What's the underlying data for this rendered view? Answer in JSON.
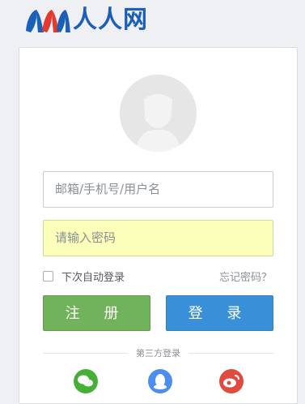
{
  "brand": {
    "name": "人人网"
  },
  "login": {
    "username_placeholder": "邮箱/手机号/用户名",
    "password_placeholder": "请输入密码",
    "remember_label": "下次自动登录",
    "forgot_label": "忘记密码？",
    "register_button": "注 册",
    "login_button": "登 录",
    "third_party_label": "第三方登录"
  },
  "social_icons": [
    "wechat-icon",
    "qq-icon",
    "weibo-icon"
  ],
  "colors": {
    "brand_blue": "#1b5fb7",
    "brand_red": "#e23a2e",
    "register_green": "#71b35b",
    "login_blue": "#3a8fd9",
    "password_field_bg": "#fbffb9"
  }
}
